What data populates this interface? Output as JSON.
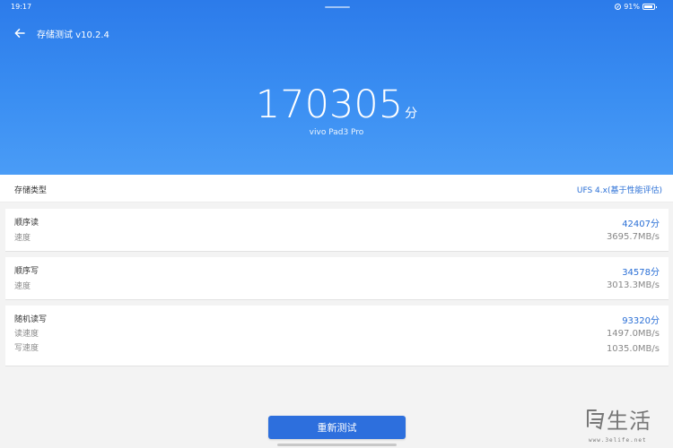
{
  "status_bar": {
    "time": "19:17",
    "battery": "91%"
  },
  "header": {
    "title": "存储测试 v10.2.4",
    "back_icon": "arrow-left-icon"
  },
  "score": {
    "value": "170305",
    "unit": "分",
    "device": "vivo Pad3 Pro"
  },
  "storage_type": {
    "label": "存储类型",
    "value": "UFS 4.x(基于性能评估)"
  },
  "sequential_read": {
    "label": "顺序读",
    "speed_label": "速度",
    "score": "42407分",
    "speed": "3695.7MB/s"
  },
  "sequential_write": {
    "label": "顺序写",
    "speed_label": "速度",
    "score": "34578分",
    "speed": "3013.3MB/s"
  },
  "random_rw": {
    "label": "随机读写",
    "read_label": "读速度",
    "write_label": "写速度",
    "score": "93320分",
    "read_speed": "1497.0MB/s",
    "write_speed": "1035.0MB/s"
  },
  "actions": {
    "retest": "重新测试"
  },
  "watermark": {
    "text": "生活",
    "url": "www.3elife.net"
  },
  "colors": {
    "header_top": "#2c7bea",
    "header_bottom": "#4a9cf6",
    "accent": "#2a6fd6",
    "button": "#2d6fdd"
  }
}
